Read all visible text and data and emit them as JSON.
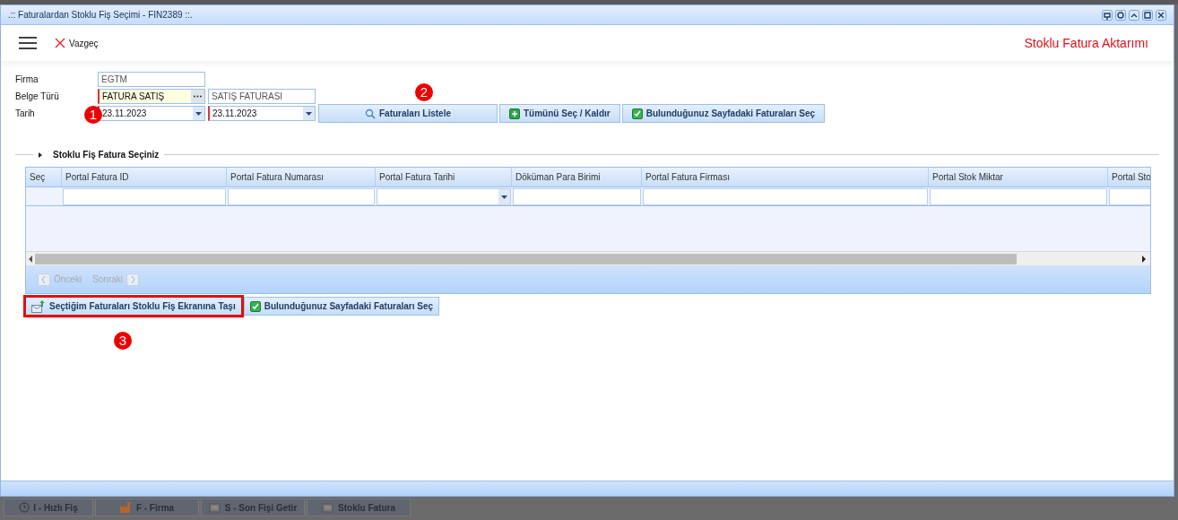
{
  "window": {
    "title": ".:: Faturalardan Stoklu Fiş Seçimi - FIN2389 ::."
  },
  "toolbar": {
    "cancel_label": "Vazgeç",
    "page_title": "Stoklu Fatura Aktarımı"
  },
  "form": {
    "rows": [
      {
        "label": "Firma",
        "fields": [
          {
            "kind": "text",
            "value": "EGTM",
            "required": false,
            "highlighted": false
          }
        ]
      },
      {
        "label": "Belge Türü",
        "fields": [
          {
            "kind": "lookup",
            "value": "FATURA SATIŞ",
            "required": true,
            "highlighted": true
          },
          {
            "kind": "text",
            "value": "SATIŞ FATURASI",
            "required": false,
            "highlighted": false
          }
        ]
      },
      {
        "label": "Tarih",
        "fields": [
          {
            "kind": "date",
            "value": "23.11.2023",
            "required": true,
            "highlighted": false
          },
          {
            "kind": "date",
            "value": "23.11.2023",
            "required": true,
            "highlighted": false
          }
        ]
      }
    ],
    "buttons": [
      {
        "kind": "search",
        "label": "Faturaları Listele"
      },
      {
        "kind": "plus",
        "label": "Tümünü Seç / Kaldır"
      },
      {
        "kind": "check",
        "label": "Bulunduğunuz Sayfadaki Faturaları Seç"
      }
    ]
  },
  "markers": [
    "1",
    "2",
    "3"
  ],
  "section": {
    "title": "Stoklu Fiş Fatura Seçiniz",
    "expanded": false
  },
  "grid": {
    "columns": [
      {
        "label": "Seç",
        "kind": "none"
      },
      {
        "label": "Portal Fatura ID",
        "kind": "text"
      },
      {
        "label": "Portal Fatura Numarası",
        "kind": "text"
      },
      {
        "label": "Portal Fatura Tarihi",
        "kind": "date"
      },
      {
        "label": "Döküman Para Birimi",
        "kind": "text"
      },
      {
        "label": "Portal Fatura Firması",
        "kind": "text"
      },
      {
        "label": "Portal Stok Miktar",
        "kind": "text"
      },
      {
        "label": "Portal Sto",
        "kind": "text"
      }
    ],
    "pager": {
      "previous": "Önceki",
      "next": "Sonraki",
      "disabled": true
    }
  },
  "actions": [
    {
      "kind": "move",
      "label": "Seçtiğim Faturaları Stoklu Fiş Ekranına Taşı",
      "highlighted": true
    },
    {
      "kind": "check",
      "label": "Bulunduğunuz Sayfadaki Faturaları Seç",
      "highlighted": false
    }
  ],
  "taskbar": [
    {
      "kind": "clock",
      "label": "I - Hızlı Fiş"
    },
    {
      "kind": "factory",
      "label": "F - Firma"
    },
    {
      "kind": "doc",
      "label": "S - Son Fişi Getir"
    },
    {
      "kind": "doc",
      "label": "Stoklu Fatura"
    }
  ]
}
